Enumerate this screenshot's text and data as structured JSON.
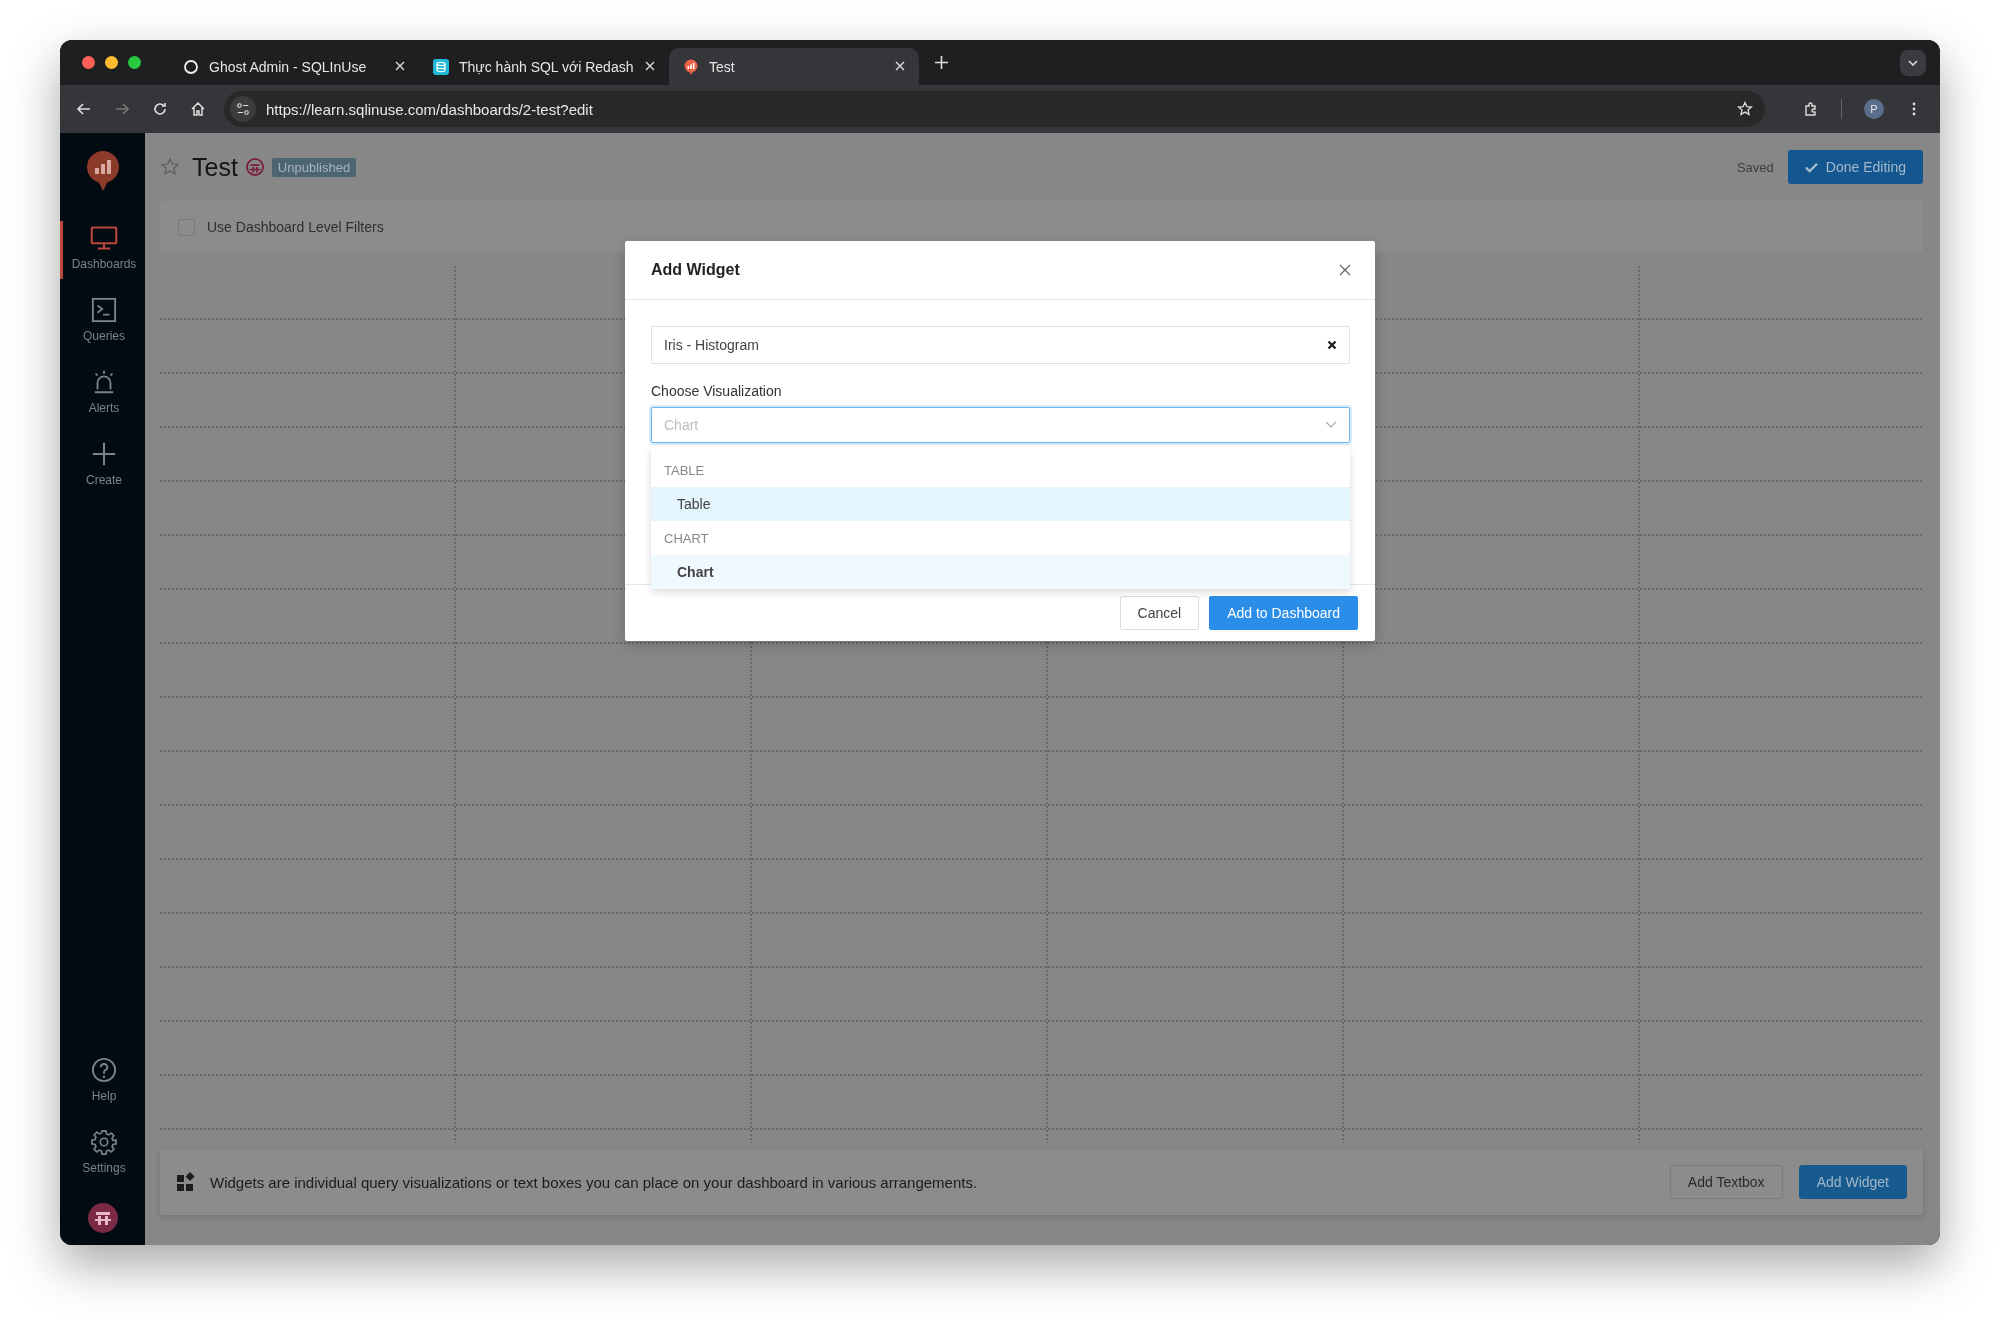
{
  "browser": {
    "tabs": [
      {
        "title": "Ghost Admin - SQLInUse",
        "kind": "ring",
        "selected": false
      },
      {
        "title": "Thực hành SQL với Redash",
        "kind": "database",
        "selected": false
      },
      {
        "title": "Test",
        "kind": "redash",
        "selected": true
      }
    ],
    "url": "https://learn.sqlinuse.com/dashboards/2-test?edit",
    "profile": "P"
  },
  "sidebar": {
    "items": [
      {
        "label": "Dashboards",
        "kind": "monitor",
        "selected": true
      },
      {
        "label": "Queries",
        "kind": "terminal",
        "selected": false
      },
      {
        "label": "Alerts",
        "kind": "alarm",
        "selected": false
      },
      {
        "label": "Create",
        "kind": "plus",
        "selected": false
      }
    ],
    "bottom_items": [
      {
        "label": "Help",
        "kind": "help"
      },
      {
        "label": "Settings",
        "kind": "gear"
      }
    ]
  },
  "dashboard": {
    "title": "Test",
    "favorite": false,
    "badge": "Unpublished",
    "status": "Saved",
    "done_button": "Done Editing",
    "filters": {
      "label": "Use Dashboard Level Filters",
      "checked": false
    }
  },
  "modal": {
    "title": "Add Widget",
    "query": "Iris - Histogram",
    "label": "Choose Visualization",
    "placeholder": "Chart",
    "groups": [
      {
        "heading": "TABLE",
        "options": [
          {
            "label": "Table",
            "selected": false,
            "hovered": true
          }
        ]
      },
      {
        "heading": "CHART",
        "options": [
          {
            "label": "Chart",
            "selected": true,
            "hovered": false
          }
        ]
      }
    ],
    "buttons": [
      {
        "label": "Cancel",
        "kind": "default"
      },
      {
        "label": "Add to Dashboard",
        "kind": "primary"
      }
    ]
  },
  "footer": {
    "text": "Widgets are individual query visualizations or text boxes you can place on your dashboard in various arrangements.",
    "buttons": [
      {
        "label": "Add Textbox",
        "kind": "default"
      },
      {
        "label": "Add Widget",
        "kind": "primary"
      }
    ]
  }
}
